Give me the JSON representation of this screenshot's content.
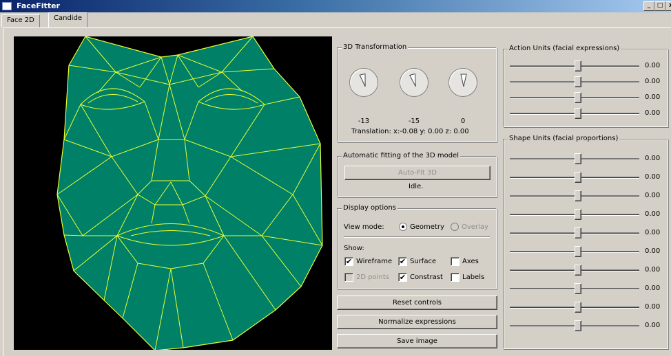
{
  "window": {
    "title": "FaceFitter",
    "controls": [
      "_",
      "□",
      "x"
    ]
  },
  "tabs": [
    {
      "label": "Face 2D",
      "active": false
    },
    {
      "label": "Candide",
      "active": true
    }
  ],
  "transformation": {
    "title": "3D Transformation",
    "dials": [
      {
        "value": "-13",
        "angle": -13
      },
      {
        "value": "-15",
        "angle": -15
      },
      {
        "value": "0",
        "angle": 0
      }
    ],
    "translation": "Translation: x:-0.08 y: 0.00 z: 0.00"
  },
  "autofit": {
    "title": "Automatic fitting of the 3D model",
    "button": "Auto-Fit 3D",
    "status": "Idle."
  },
  "display": {
    "title": "Display options",
    "view_mode_label": "View mode:",
    "geometry": "Geometry",
    "overlay": "Overlay",
    "show_label": "Show:",
    "wireframe": "Wireframe",
    "surface": "Surface",
    "axes": "Axes",
    "points2d": "2D points",
    "constrast": "Constrast",
    "labels": "Labels"
  },
  "buttons": {
    "reset": "Reset controls",
    "normalize": "Normalize expressions",
    "save": "Save image"
  },
  "action_units": {
    "title": "Action Units (facial expressions)",
    "values": [
      "0.00",
      "0.00",
      "0.00",
      "0.00"
    ]
  },
  "shape_units": {
    "title": "Shape Units (facial proportions)",
    "values": [
      "0.00",
      "0.00",
      "0.00",
      "0.00",
      "0.00",
      "0.00",
      "0.00",
      "0.00",
      "0.00",
      "0.00"
    ]
  },
  "colors": {
    "face_fill": "#008066",
    "wire": "#e6ff33",
    "background": "#000000"
  }
}
